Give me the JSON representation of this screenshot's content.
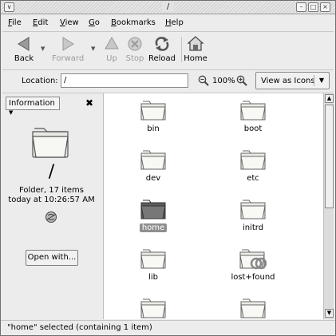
{
  "window": {
    "title": "/",
    "controls": {
      "menu": "∨",
      "minimize": "–",
      "maximize": "□",
      "close": "×"
    }
  },
  "menubar": {
    "items": [
      {
        "label": "File",
        "mnemonic": "F",
        "rest": "ile"
      },
      {
        "label": "Edit",
        "mnemonic": "E",
        "rest": "dit"
      },
      {
        "label": "View",
        "mnemonic": "V",
        "rest": "iew"
      },
      {
        "label": "Go",
        "mnemonic": "G",
        "rest": "o"
      },
      {
        "label": "Bookmarks",
        "mnemonic": "B",
        "rest": "ookmarks"
      },
      {
        "label": "Help",
        "mnemonic": "H",
        "rest": "elp"
      }
    ]
  },
  "toolbar": {
    "back": "Back",
    "forward": "Forward",
    "up": "Up",
    "stop": "Stop",
    "reload": "Reload",
    "home": "Home"
  },
  "location": {
    "label": "Location:",
    "value": "/",
    "zoom": "100%",
    "view_mode": "View as Icons"
  },
  "sidepane": {
    "selector": "Information",
    "name": "/",
    "info_line1": "Folder, 17 items",
    "info_line2": "today at 10:26:57 AM",
    "open_with": "Open with..."
  },
  "files": [
    {
      "name": "bin",
      "selected": false,
      "emblem": false
    },
    {
      "name": "boot",
      "selected": false,
      "emblem": false
    },
    {
      "name": "dev",
      "selected": false,
      "emblem": false
    },
    {
      "name": "etc",
      "selected": false,
      "emblem": false
    },
    {
      "name": "home",
      "selected": true,
      "emblem": false
    },
    {
      "name": "initrd",
      "selected": false,
      "emblem": false
    },
    {
      "name": "lib",
      "selected": false,
      "emblem": false
    },
    {
      "name": "lost+found",
      "selected": false,
      "emblem": true
    },
    {
      "name": "",
      "selected": false,
      "emblem": false
    },
    {
      "name": "",
      "selected": false,
      "emblem": false
    }
  ],
  "status": "\"home\" selected (containing 1 item)",
  "icons": {
    "back": "arrow-left-icon",
    "forward": "arrow-right-icon",
    "up": "arrow-up-icon",
    "stop": "stop-icon",
    "reload": "reload-icon",
    "home": "home-icon",
    "folder": "folder-icon",
    "zoom_out": "zoom-out-icon",
    "zoom_in": "zoom-in-icon",
    "emblem": "emblem-unreadable-icon"
  },
  "colors": {
    "selection": "#8f8f8f",
    "folder_fill": "#f0f0ec",
    "folder_selected": "#6b6b6b"
  }
}
